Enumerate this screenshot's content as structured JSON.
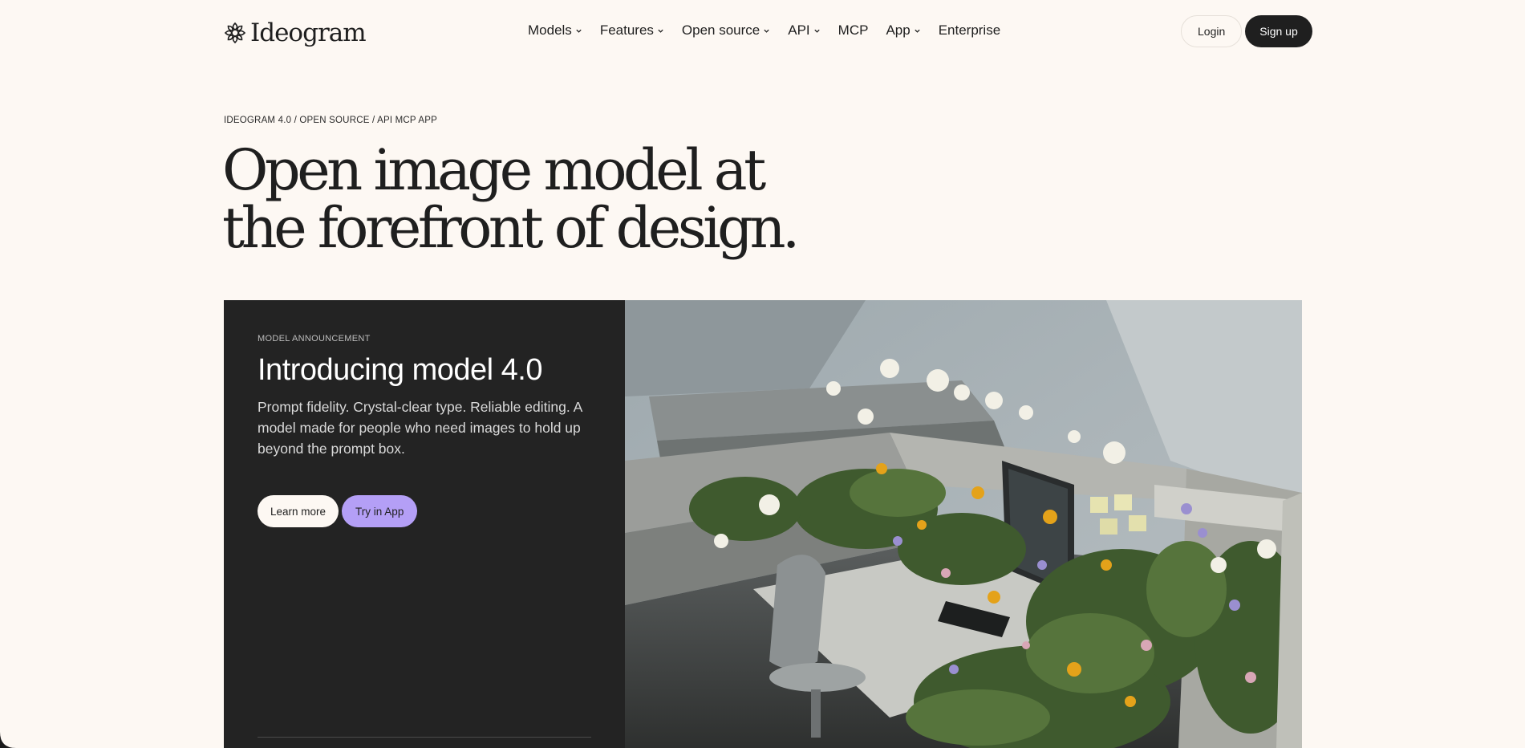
{
  "header": {
    "logo_text": "Ideogram",
    "nav": [
      {
        "label": "Models",
        "has_dropdown": true
      },
      {
        "label": "Features",
        "has_dropdown": true
      },
      {
        "label": "Open source",
        "has_dropdown": true
      },
      {
        "label": "API",
        "has_dropdown": true
      },
      {
        "label": "MCP",
        "has_dropdown": false
      },
      {
        "label": "App",
        "has_dropdown": true
      },
      {
        "label": "Enterprise",
        "has_dropdown": false
      }
    ],
    "login_label": "Login",
    "signup_label": "Sign up"
  },
  "hero": {
    "breadcrumb": "IDEOGRAM 4.0 / OPEN SOURCE / API MCP APP",
    "headline_line1": "Open image model at",
    "headline_line2": "the forefront of design."
  },
  "card": {
    "eyebrow": "MODEL ANNOUNCEMENT",
    "title": "Introducing model 4.0",
    "description": "Prompt fidelity. Crystal-clear type. Reliable editing. A model made for people who need images to hold up beyond the prompt box.",
    "learn_more_label": "Learn more",
    "try_label": "Try in App",
    "image_icon": "office-cubicles-with-wildflowers-image"
  },
  "colors": {
    "page_bg": "#fdf8f3",
    "ink": "#1f1f1f",
    "card_dark": "#232323",
    "accent_purple": "#b49ff6"
  }
}
